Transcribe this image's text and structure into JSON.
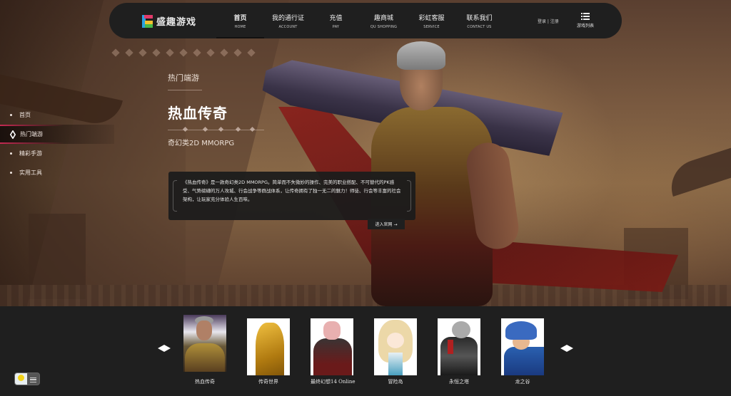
{
  "nav": {
    "brand": "盛趣游戏",
    "items": [
      {
        "zh": "首页",
        "en": "HOME",
        "active": true
      },
      {
        "zh": "我的通行证",
        "en": "ACCOUNT"
      },
      {
        "zh": "充值",
        "en": "PAY"
      },
      {
        "zh": "趣商城",
        "en": "QU SHOPPING"
      },
      {
        "zh": "彩虹客服",
        "en": "SERVICE"
      },
      {
        "zh": "联系我们",
        "en": "CONTACT US"
      }
    ],
    "login": "登录 | 注册",
    "game_list": "游戏列表"
  },
  "sidebar": {
    "items": [
      {
        "label": "首页"
      },
      {
        "label": "热门端游",
        "active": true
      },
      {
        "label": "精彩手游"
      },
      {
        "label": "实用工具"
      }
    ]
  },
  "hero": {
    "category": "热门端游",
    "title": "热血传奇",
    "subtitle": "奇幻类2D MMORPG",
    "description": "《热血传奇》是一款奇幻类2D MMORPG。简单而不失微妙的操作、完美的职业搭配、不可替代的PK感受、气势磅礴的万人攻城、行会战争等群战体系，让传奇拥有了独一无二的魅力！师徒、行会等丰富的社会架构，让玩家充分体验人生百味。",
    "enter_label": "进入官网 →"
  },
  "games": {
    "items": [
      {
        "name": "热血传奇",
        "icon": "legend-of-mir-thumb"
      },
      {
        "name": "传奇世界",
        "icon": "mir-world-thumb"
      },
      {
        "name": "最终幻想14 Online",
        "icon": "ff14-thumb"
      },
      {
        "name": "冒险岛",
        "icon": "maplestory-thumb"
      },
      {
        "name": "永恒之塔",
        "icon": "aion-thumb"
      },
      {
        "name": "龙之谷",
        "icon": "dragon-nest-thumb"
      }
    ]
  },
  "colors": {
    "accent": "#c42a52",
    "nav_bg": "#1f1f1f",
    "bottom_bg": "#1f1f1f"
  }
}
